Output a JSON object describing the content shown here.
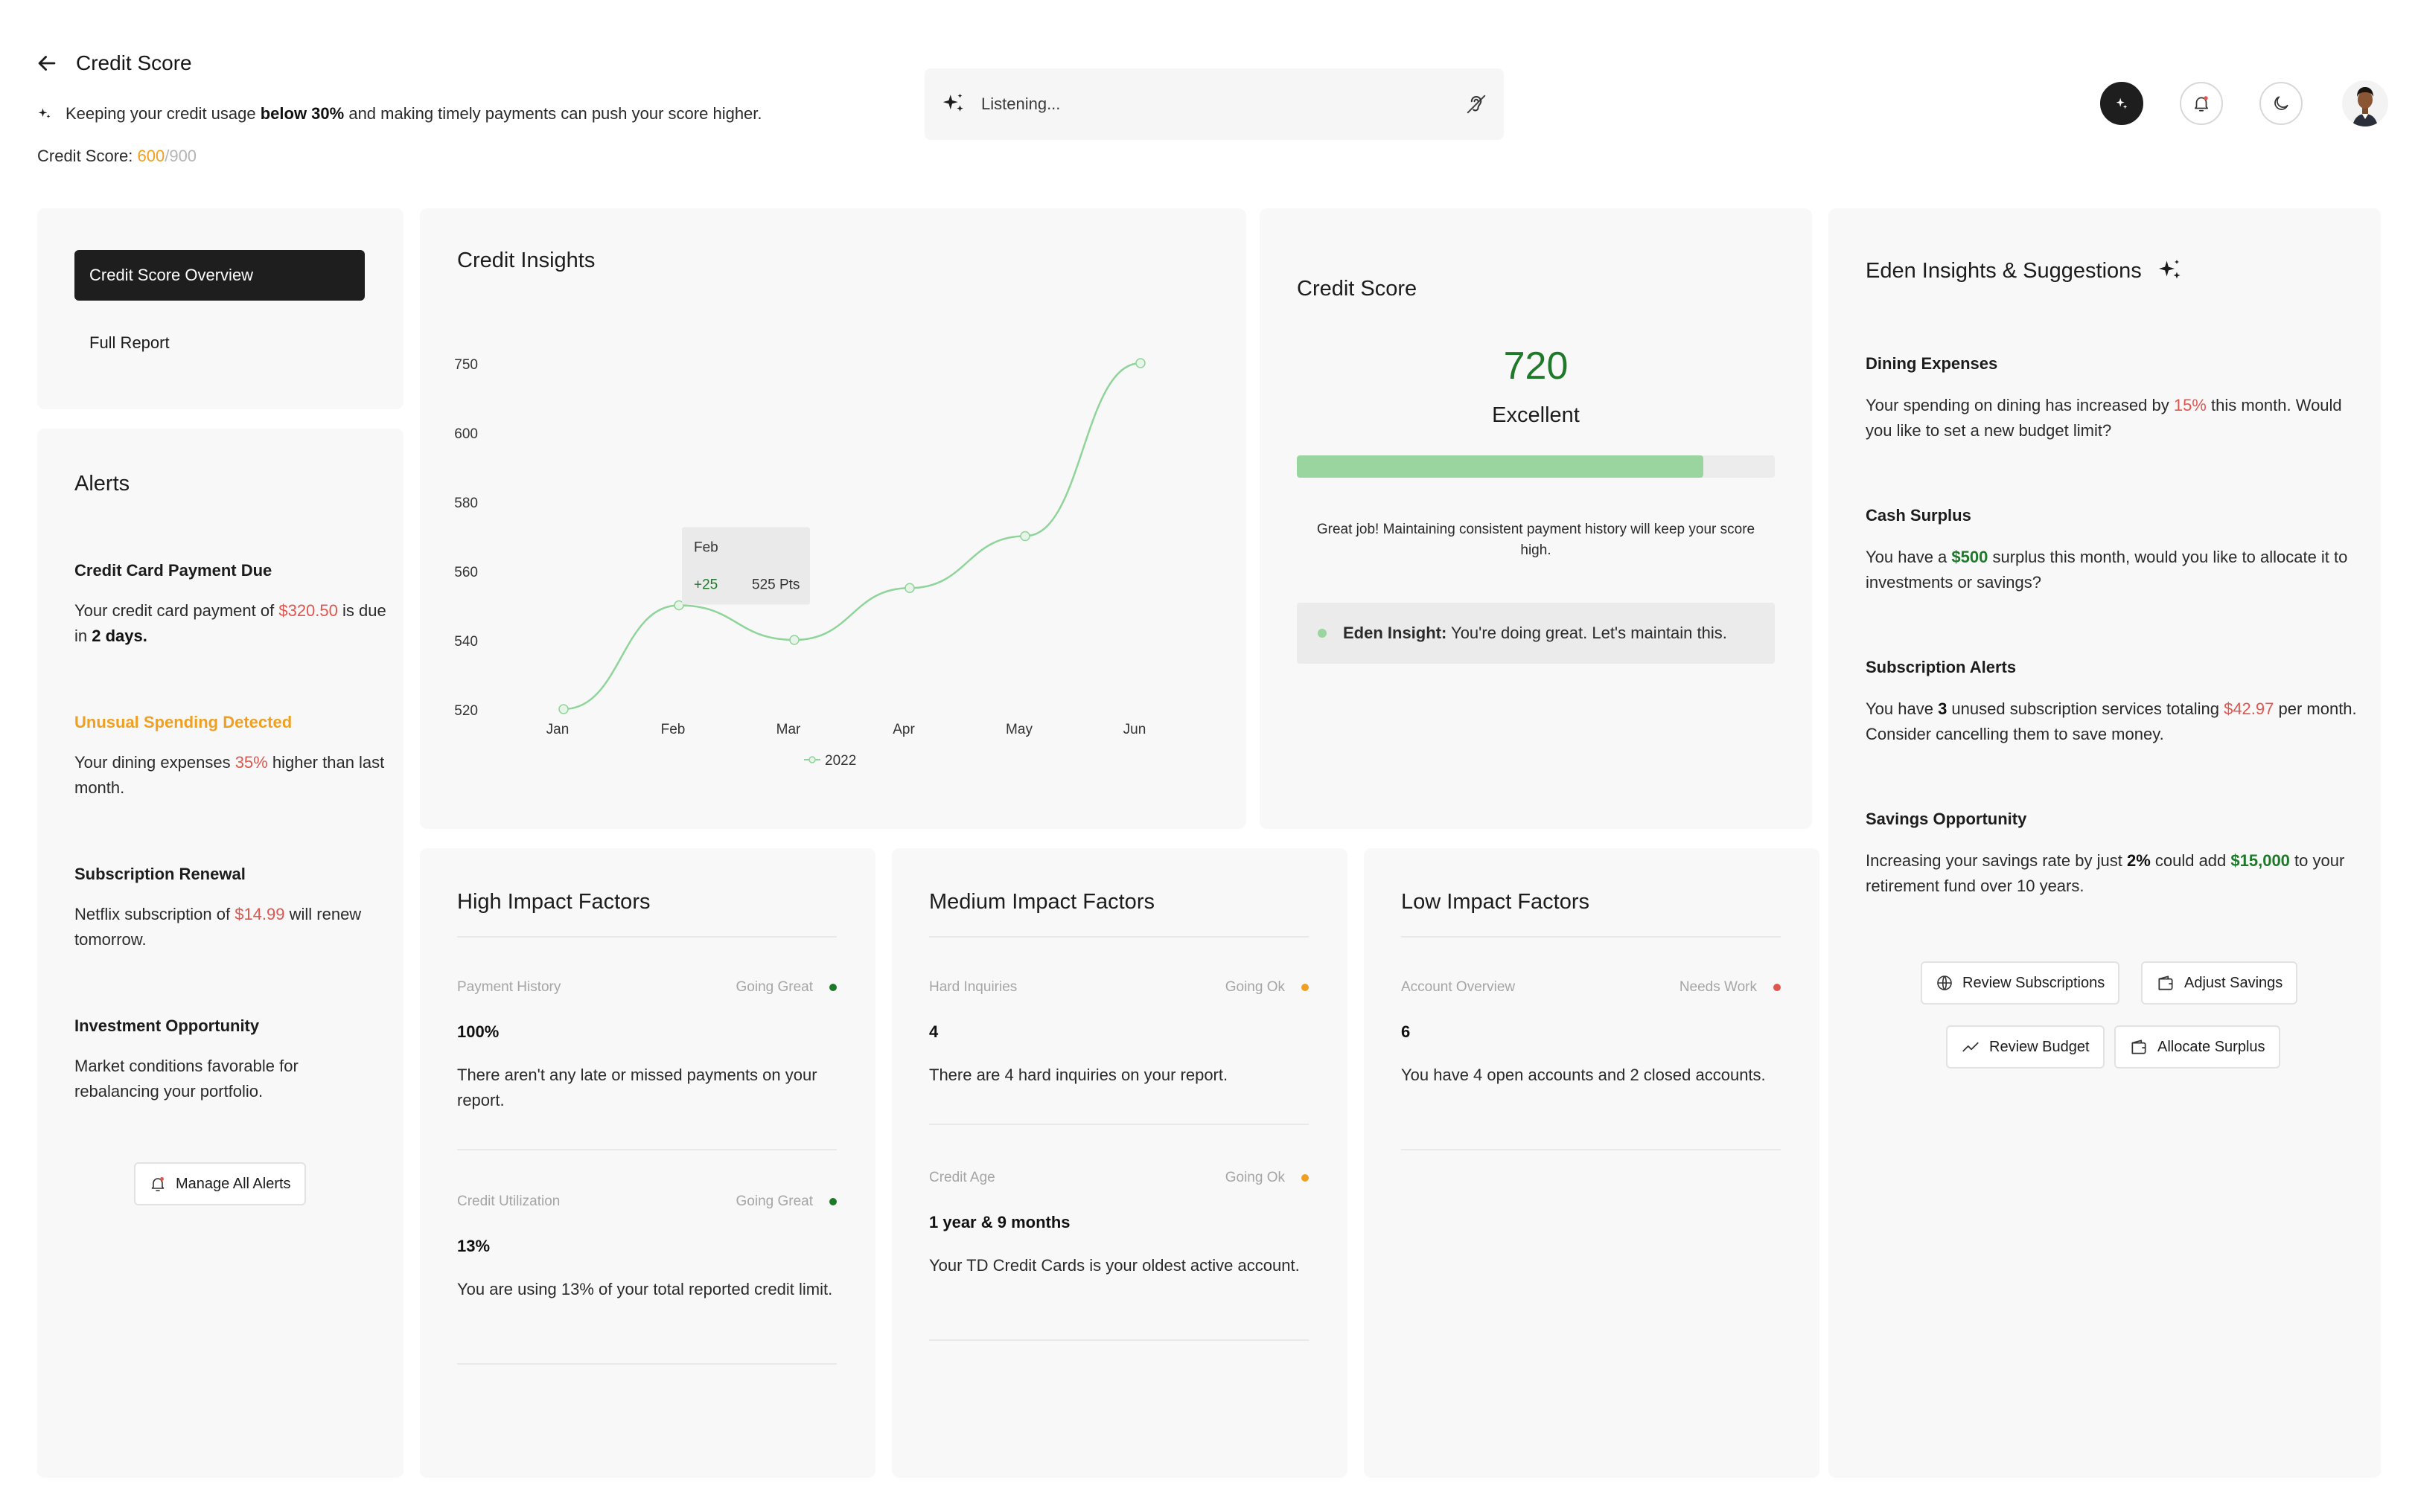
{
  "header": {
    "title": "Credit Score",
    "tip_prefix": "Keeping your credit usage ",
    "tip_bold": "below 30%",
    "tip_suffix": " and making timely payments can push your score higher.",
    "score_label": "Credit Score: ",
    "score_value": "600",
    "score_max": "/900",
    "listening_text": "Listening..."
  },
  "nav": {
    "active": "Credit Score Overview",
    "item": "Full Report"
  },
  "alerts": {
    "title": "Alerts",
    "items": [
      {
        "heading": "Credit Card Payment Due",
        "pre": "Your credit card payment of ",
        "highlight": "$320.50",
        "mid": " is due in ",
        "bold": "2 days."
      },
      {
        "heading": "Unusual Spending Detected",
        "pre": "Your dining expenses ",
        "highlight": "35%",
        "post": " higher than last month."
      },
      {
        "heading": "Subscription Renewal",
        "pre": "Netflix subscription of ",
        "highlight": "$14.99",
        "post": " will renew tomorrow."
      },
      {
        "heading": "Investment Opportunity",
        "text": "Market conditions favorable for rebalancing your portfolio."
      }
    ],
    "manage_label": "Manage All Alerts"
  },
  "chart_data": {
    "type": "line",
    "title": "Credit Insights",
    "categories": [
      "Jan",
      "Feb",
      "Mar",
      "Apr",
      "May",
      "Jun"
    ],
    "y_tick_labels": [
      "750",
      "600",
      "580",
      "560",
      "540",
      "520"
    ],
    "series": [
      {
        "name": "2022",
        "values": [
          520,
          550,
          540,
          555,
          570,
          750
        ]
      }
    ],
    "tooltip": {
      "month": "Feb",
      "change": "+25",
      "points": "525 Pts"
    },
    "legend": "bottom-center",
    "color": "#8fd49a"
  },
  "score_card": {
    "title": "Credit Score",
    "score": "720",
    "rating": "Excellent",
    "progress_fraction": 0.85,
    "message": "Great job! Maintaining consistent payment history will keep your score high.",
    "insight_label": "Eden Insight:",
    "insight_text": " You're doing great. Let's maintain this."
  },
  "high_factors": {
    "title": "High Impact Factors",
    "items": [
      {
        "name": "Payment History",
        "status": "Going Great",
        "color": "#1e7a2a",
        "value": "100%",
        "desc": "There aren't any late or missed payments on your report."
      },
      {
        "name": "Credit Utilization",
        "status": "Going Great",
        "color": "#1e7a2a",
        "value": "13%",
        "desc": "You are using 13% of your total reported credit limit."
      }
    ]
  },
  "medium_factors": {
    "title": "Medium Impact Factors",
    "items": [
      {
        "name": "Hard Inquiries",
        "status": "Going Ok",
        "color": "#f0a020",
        "value": "4",
        "desc": "There are 4 hard inquiries on your report."
      },
      {
        "name": "Credit Age",
        "status": "Going Ok",
        "color": "#f0a020",
        "value": "1 year & 9 months",
        "desc": "Your TD Credit Cards is your oldest active account."
      }
    ]
  },
  "low_factors": {
    "title": "Low Impact Factors",
    "items": [
      {
        "name": "Account Overview",
        "status": "Needs Work",
        "color": "#e0564f",
        "value": "6",
        "desc": "You have 4 open accounts and 2 closed accounts."
      }
    ]
  },
  "eden": {
    "title": "Eden Insights & Suggestions",
    "items": [
      {
        "heading": "Dining Expenses",
        "pre": "Your spending on dining has increased by ",
        "hl": "15%",
        "hl_type": "red",
        "post": " this month. Would you like to set a new budget limit?"
      },
      {
        "heading": "Cash Surplus",
        "pre": "You have a ",
        "hl": "$500",
        "hl_type": "green",
        "post": " surplus this month, would you like to allocate it to investments or savings?"
      },
      {
        "heading": "Subscription Alerts",
        "pre": "You have ",
        "bold": "3",
        "mid": " unused subscription services totaling ",
        "hl": "$42.97",
        "hl_type": "red",
        "post": " per month. Consider cancelling them to save money."
      },
      {
        "heading": "Savings Opportunity",
        "pre": "Increasing your savings rate by just ",
        "bold": "2%",
        "mid": " could add ",
        "hl": "$15,000",
        "hl_type": "green",
        "post": " to your retirement fund over 10 years."
      }
    ],
    "buttons": {
      "review_subscriptions": "Review Subscriptions",
      "adjust_savings": "Adjust Savings",
      "review_budget": "Review Budget",
      "allocate_surplus": "Allocate Surplus"
    }
  }
}
